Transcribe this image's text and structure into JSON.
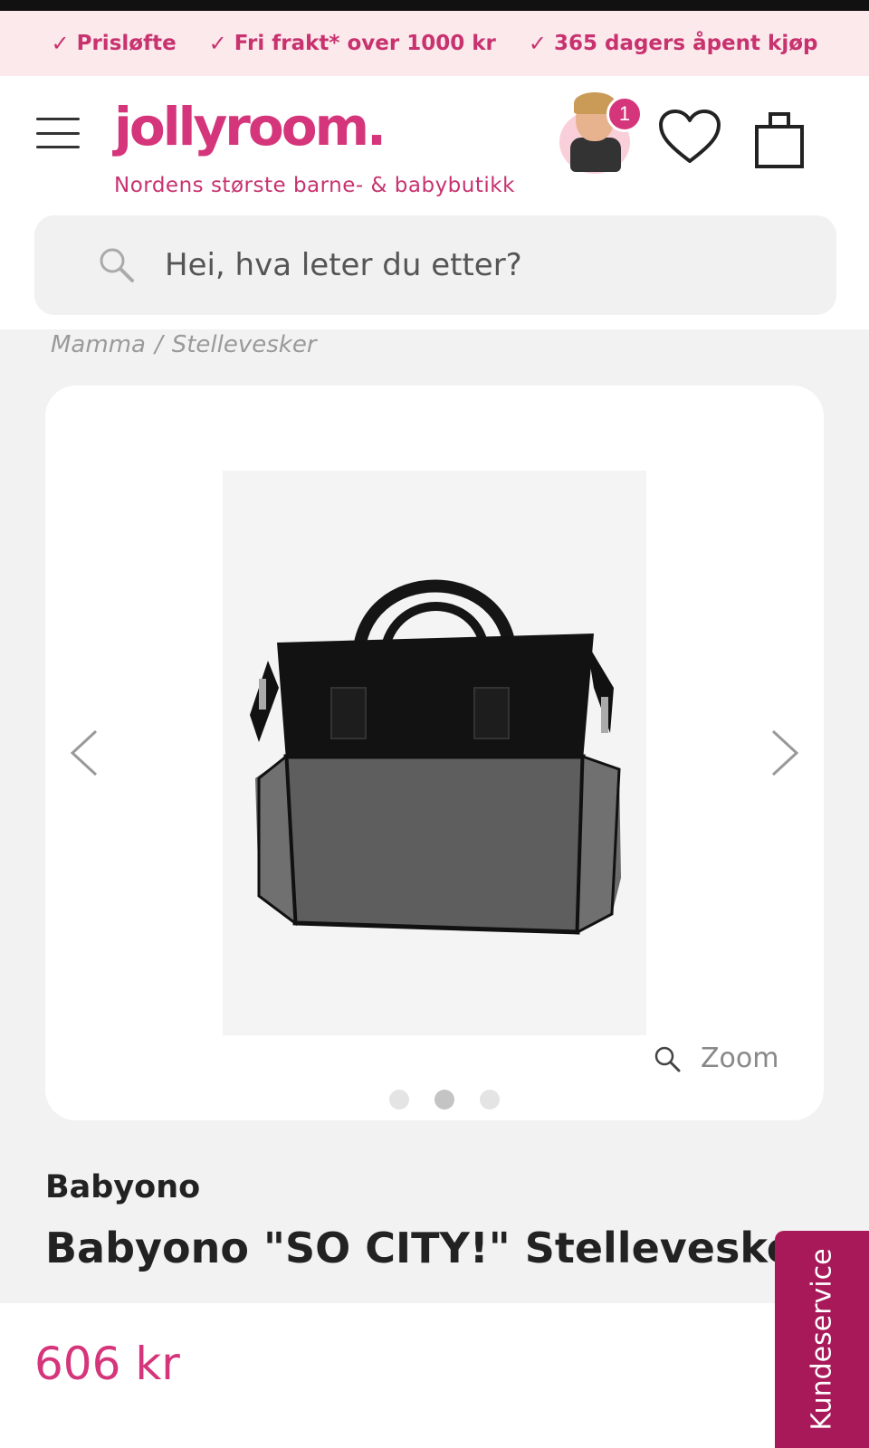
{
  "usp_bar": {
    "items": [
      "Prisløfte",
      "Fri frakt* over 1000 kr",
      "365 dagers åpent kjøp"
    ],
    "check": "✓"
  },
  "header": {
    "logo_text": "jollyroom.",
    "tagline": "Nordens største barne- & babybutikk",
    "notification_count": "1",
    "brand_color": "#d5357a"
  },
  "search": {
    "placeholder": "Hei, hva leter du etter?"
  },
  "breadcrumb": {
    "items": [
      "Mamma",
      "Stellevesker"
    ],
    "separator": "/"
  },
  "gallery": {
    "zoom_label": "Zoom",
    "image_count": 3,
    "active_index": 1
  },
  "product": {
    "brand": "Babyono",
    "title": "Babyono \"SO CITY!\" Stelleveske,",
    "price": "606 kr"
  },
  "support": {
    "label": "Kundeservice",
    "color": "#a8195a"
  }
}
